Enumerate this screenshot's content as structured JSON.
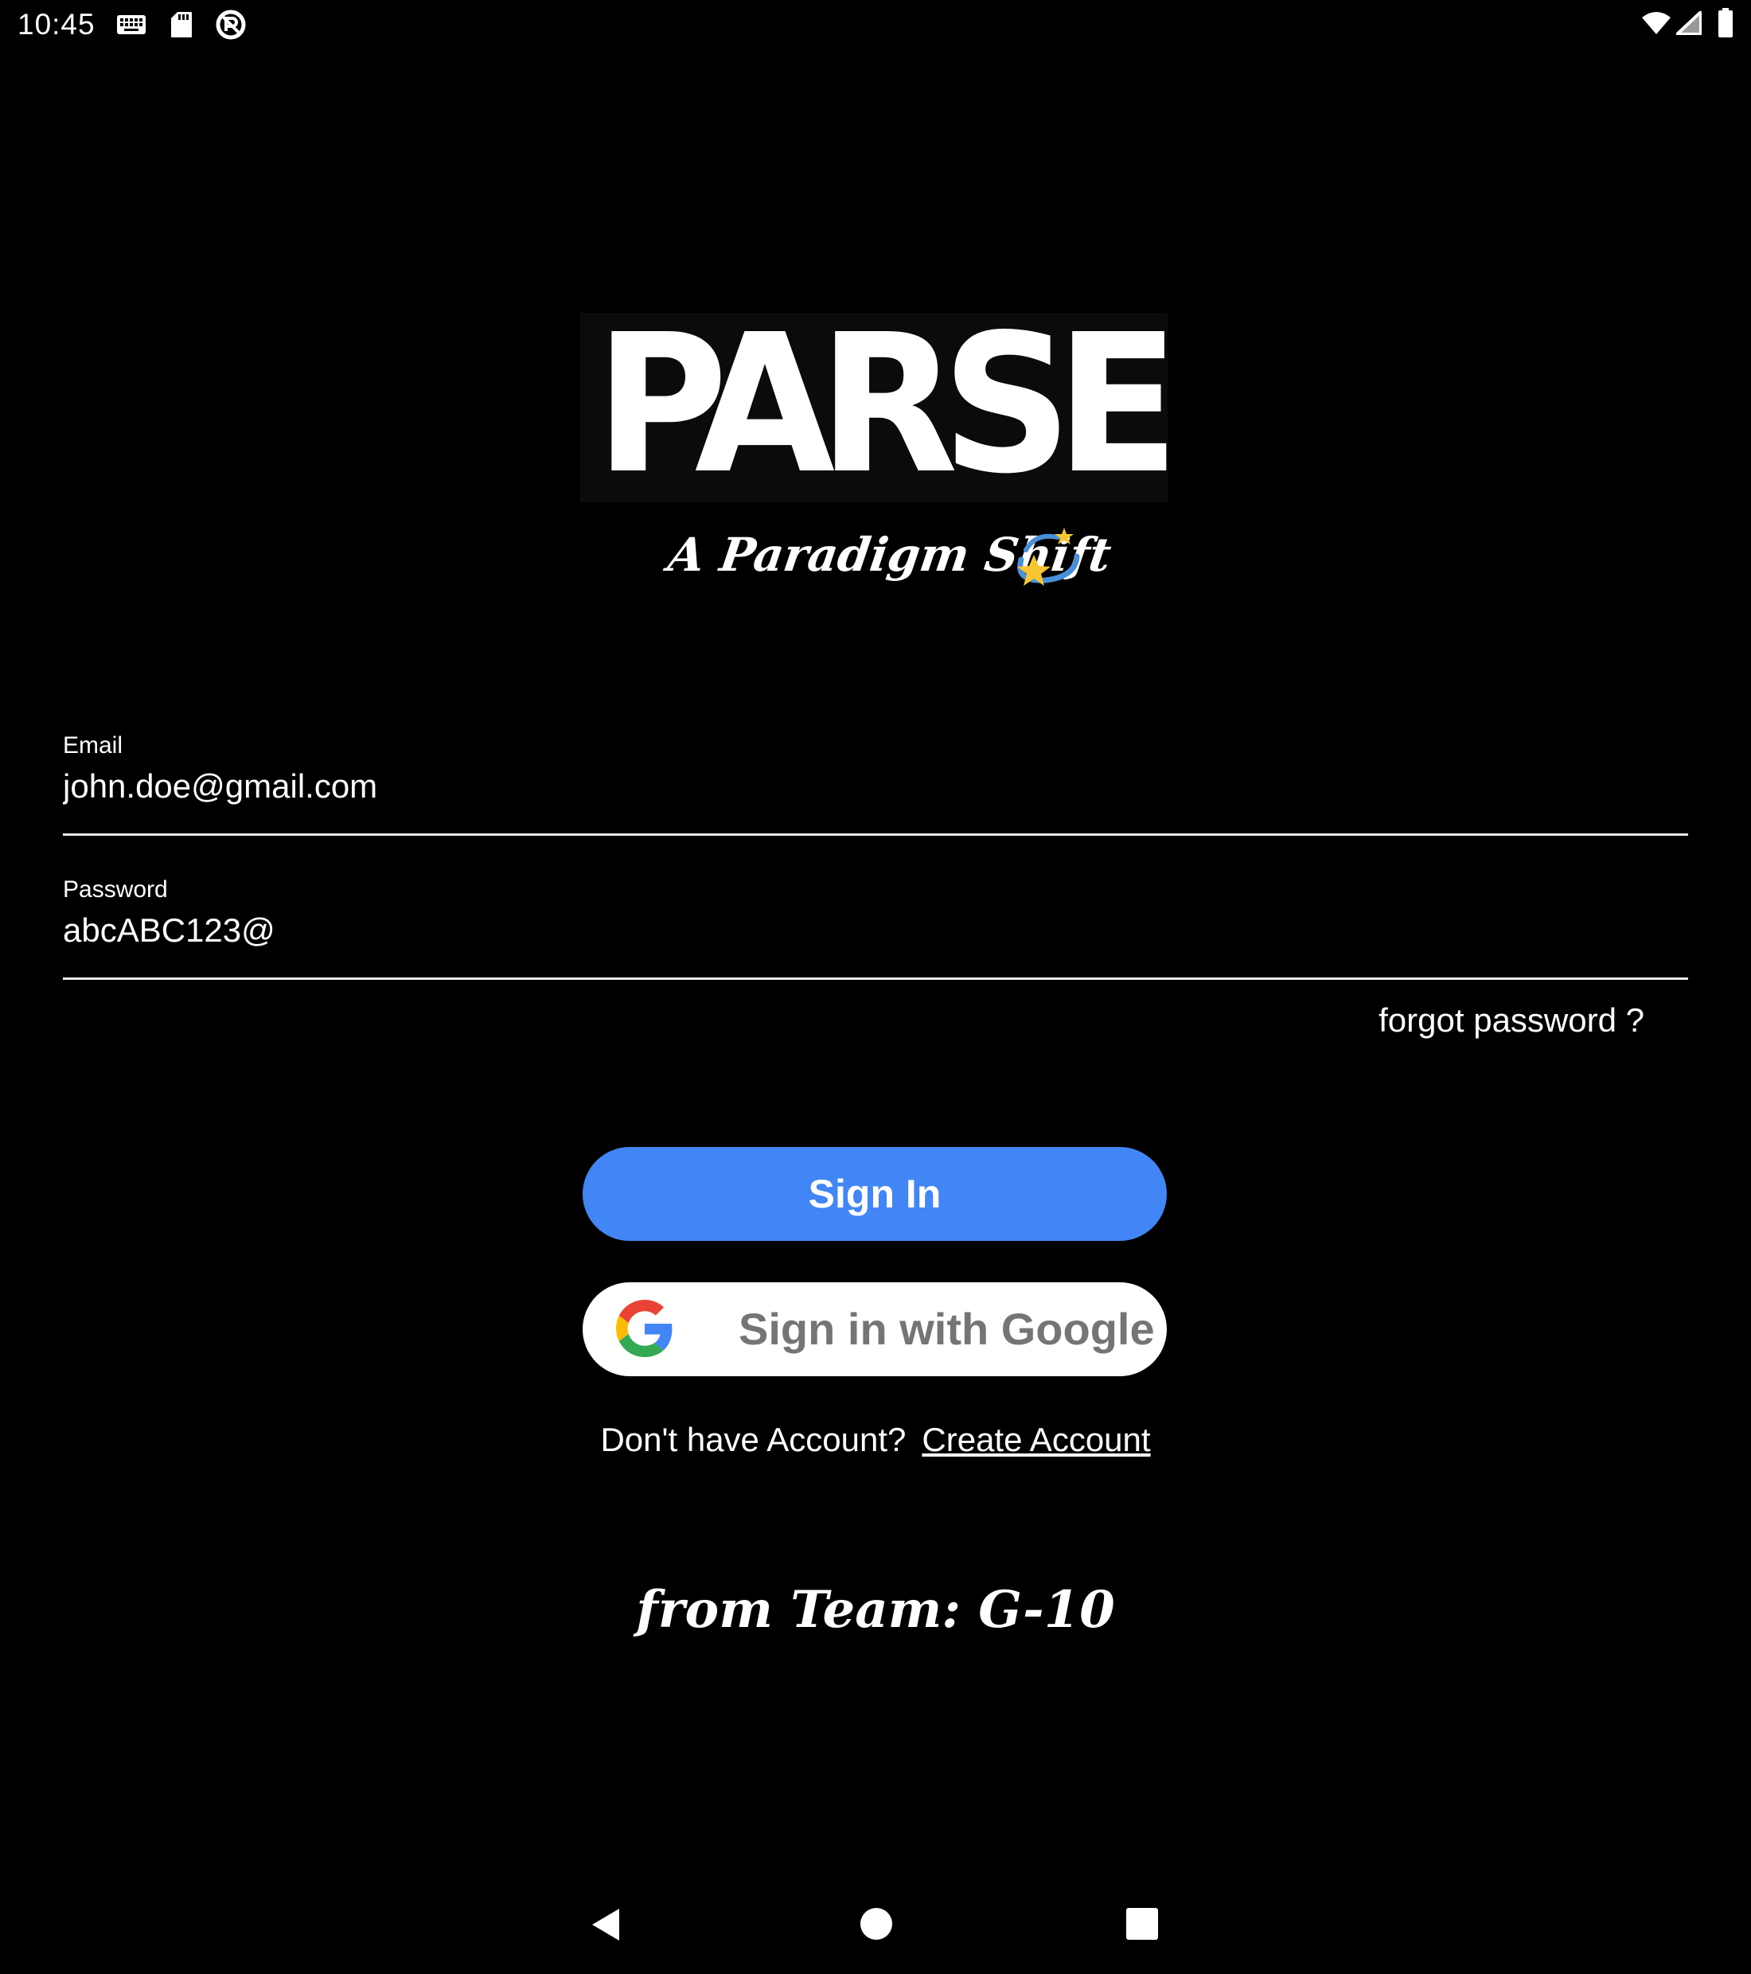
{
  "status_bar": {
    "time": "10:45",
    "left_icons": [
      "keyboard-icon",
      "sd-card-icon",
      "no-location-icon"
    ],
    "right_icons": [
      "wifi-icon",
      "signal-icon",
      "battery-icon"
    ]
  },
  "app": {
    "logo_text": "PARSEC",
    "tagline": "A Paradigm Shift",
    "tagline_emoji": "dizzy-star-emoji"
  },
  "form": {
    "email": {
      "label": "Email",
      "value": "john.doe@gmail.com"
    },
    "password": {
      "label": "Password",
      "value": "abcABC123@"
    },
    "forgot_label": "forgot password ?"
  },
  "buttons": {
    "sign_in": "Sign In",
    "google": "Sign in with Google"
  },
  "account": {
    "prompt": "Don't have Account?",
    "create_link": "Create Account"
  },
  "footer": {
    "team": "from Team: G-10"
  },
  "nav_bar": {
    "icons": [
      "back-icon",
      "home-icon",
      "recents-icon"
    ]
  },
  "colors": {
    "background": "#000000",
    "primary_button": "#4286f5",
    "google_button": "#ffffff",
    "google_text": "#757575"
  }
}
